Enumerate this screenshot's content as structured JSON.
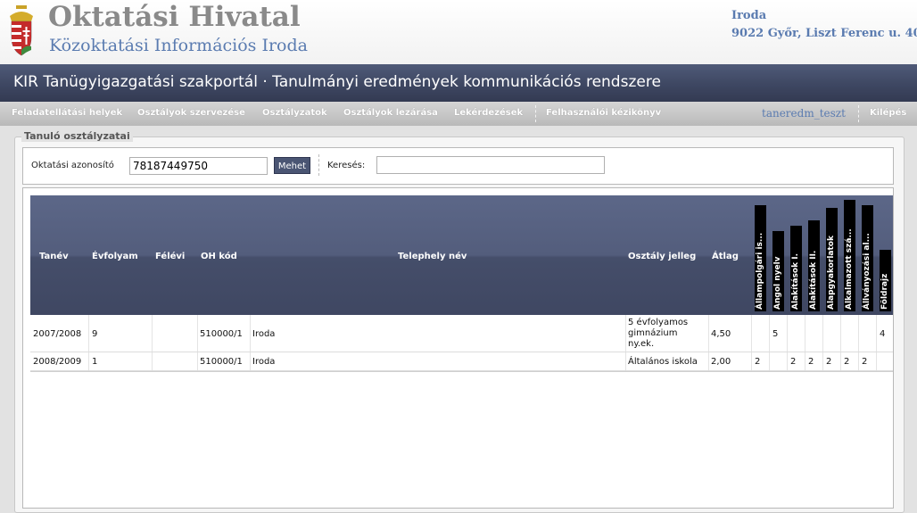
{
  "header": {
    "org_name": "Oktatási Hivatal",
    "office_name": "Közoktatási Információs Iroda",
    "address_line1": "Iroda",
    "address_line2": "9022 Győr, Liszt Ferenc u. 40."
  },
  "portal_title": "KIR Tanügyigazgatási szakportál · Tanulmányi eredmények kommunikációs rendszere",
  "menu": {
    "items": [
      "Feladatellátási helyek",
      "Osztályok szervezése",
      "Osztályzatok",
      "Osztályok lezárása",
      "Lekérdezések",
      "Felhasználói kézikönyv"
    ],
    "user": "taneredm_teszt",
    "logout": "Kilépés"
  },
  "panel": {
    "legend": "Tanuló osztályzatai"
  },
  "search": {
    "id_label": "Oktatási azonosító",
    "id_value": "78187449750",
    "go_button": "Mehet",
    "search_label": "Keresés:",
    "search_value": ""
  },
  "table": {
    "columns": [
      "Tanév",
      "Évfolyam",
      "Félévi",
      "OH kód",
      "Telephely név",
      "Osztály jelleg",
      "Átlag"
    ],
    "subject_columns": [
      "Állampolgári is...",
      "Angol nyelv",
      "Alakítások I.",
      "Alakítások II.",
      "Alapgyakorlatok",
      "Alkalmazott szá...",
      "Állványozási al...",
      "Földrajz"
    ],
    "rows": [
      {
        "tanev": "2007/2008",
        "evfolyam": "9",
        "felevi": "",
        "oh_kod": "510000/1",
        "telephely": "Iroda",
        "jelleg_lines": [
          "5 évfolyamos",
          "gimnázium",
          "ny.ek."
        ],
        "atlag": "4,50",
        "grades": [
          "",
          "5",
          "",
          "",
          "",
          "",
          "",
          "4"
        ]
      },
      {
        "tanev": "2008/2009",
        "evfolyam": "1",
        "felevi": "",
        "oh_kod": "510000/1",
        "telephely": "Iroda",
        "jelleg_lines": [
          "Általános iskola"
        ],
        "atlag": "2,00",
        "grades": [
          "2",
          "",
          "2",
          "2",
          "2",
          "2",
          "2",
          ""
        ]
      }
    ]
  },
  "colors": {
    "portal_bar": "#3e4762",
    "menu_bar": "#c4c4c4",
    "accent_blue": "#5a7bb0",
    "table_header": "#4d5775"
  }
}
